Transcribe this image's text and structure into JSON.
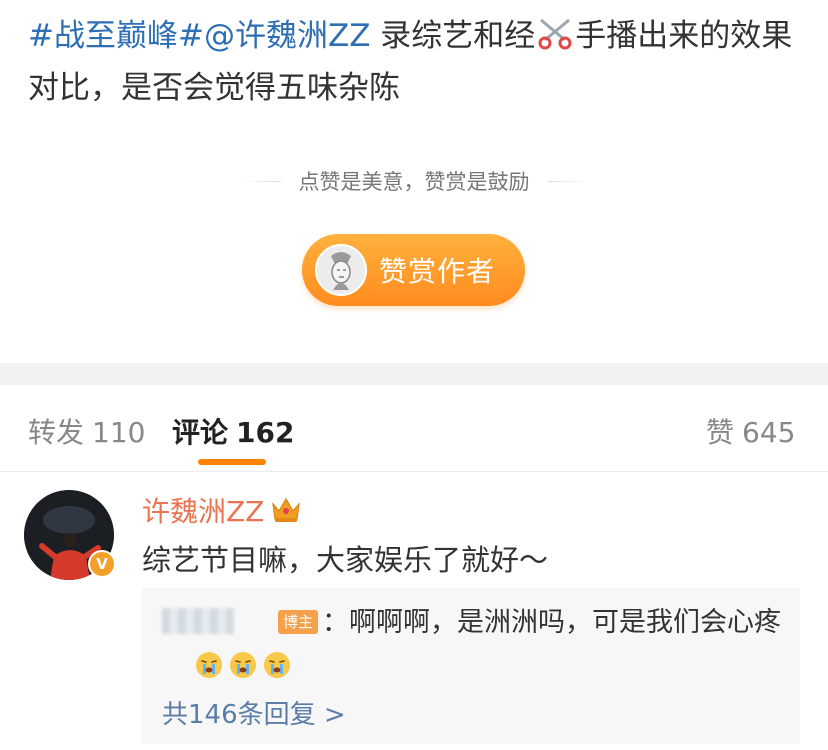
{
  "post": {
    "hashtag": "#战至巅峰#",
    "mention": "@许魏洲ZZ",
    "text_part1": " 录综艺和经",
    "scissors_icon": "scissors-icon",
    "text_part2": "手播出来的效果对比，是否会觉得五味杂陈"
  },
  "reward": {
    "hint": "点赞是美意，赞赏是鼓励",
    "button_label": "赞赏作者",
    "accent_color": "#ff8c1e"
  },
  "tabs": {
    "repost": {
      "label": "转发",
      "count": "110"
    },
    "comments": {
      "label": "评论",
      "count": "162"
    },
    "likes": {
      "label": "赞",
      "count": "645"
    },
    "active_color": "#ff8200"
  },
  "comment": {
    "author": "许魏洲ZZ",
    "author_color": "#eb7350",
    "text": "综艺节目嘛，大家娱乐了就好～",
    "reply": {
      "badge": "博主",
      "text": "：啊啊啊，是洲洲吗，可是我们会心疼",
      "emojis": [
        "crying-emoji",
        "crying-emoji",
        "crying-emoji"
      ],
      "more_link": "共146条回复 >"
    }
  }
}
